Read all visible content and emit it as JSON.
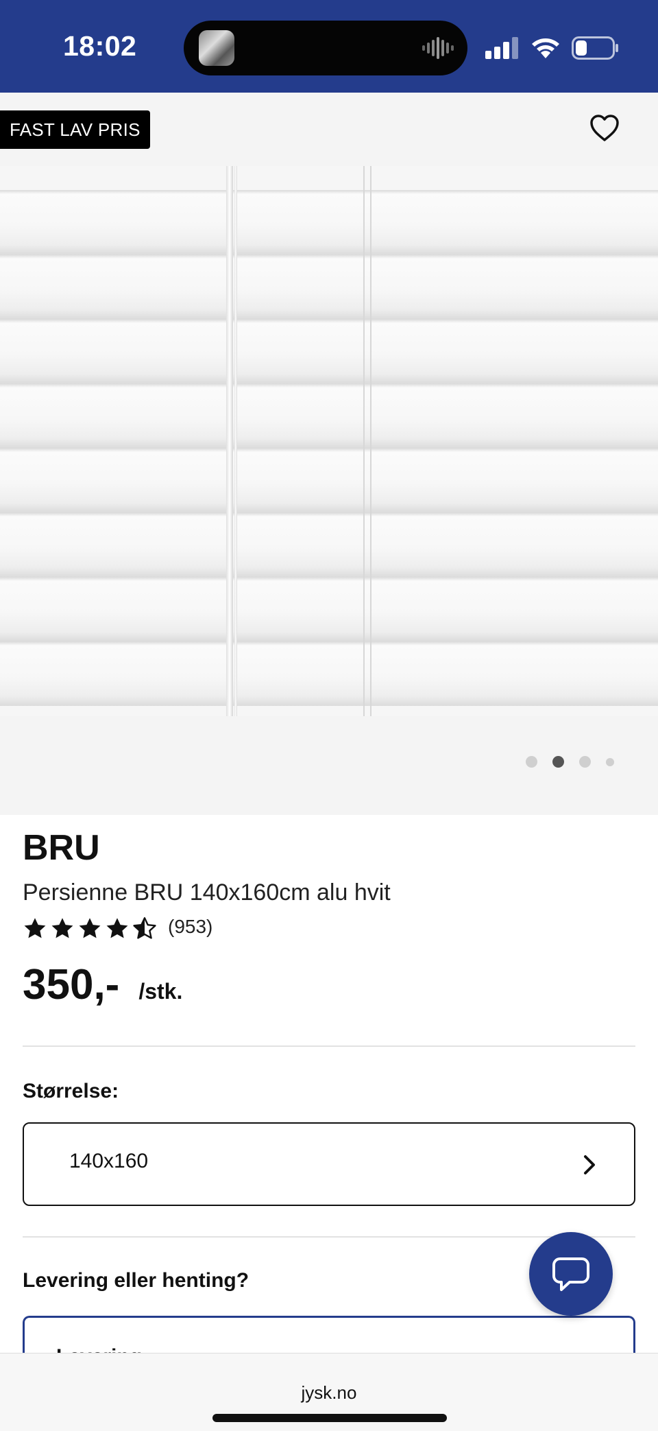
{
  "status_bar": {
    "time": "18:02",
    "icons": [
      "signal-icon",
      "wifi-icon",
      "battery-icon"
    ],
    "background": "#243c8c"
  },
  "topbar": {
    "badge": "FAST LAV PRIS",
    "favorite_icon": "heart-icon"
  },
  "gallery": {
    "image": "white-venetian-blind",
    "page_count": 4,
    "active_index": 1
  },
  "product": {
    "brand": "BRU",
    "name": "Persienne BRU 140x160cm alu hvit",
    "rating": 4.5,
    "rating_count": "(953)",
    "price": "350,-",
    "unit": "/stk."
  },
  "size": {
    "label": "Størrelse:",
    "value": "140x160"
  },
  "delivery": {
    "label": "Levering eller henting?",
    "option": "Levering"
  },
  "chat": {
    "icon": "chat-bubble-icon"
  },
  "browser": {
    "url": "jysk.no"
  },
  "colors": {
    "brand_blue": "#243c8c",
    "text": "#111111"
  }
}
